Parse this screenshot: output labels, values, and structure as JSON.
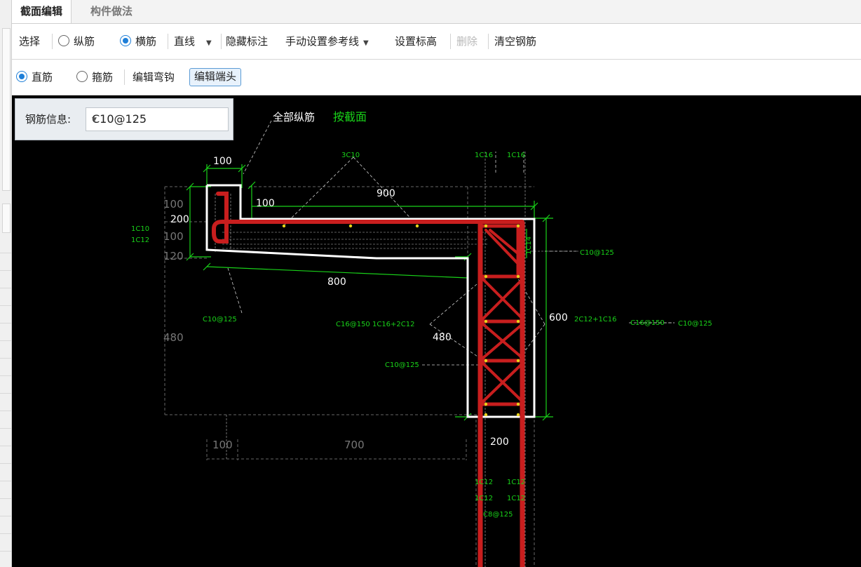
{
  "tabs": [
    {
      "label": "截面编辑",
      "active": true
    },
    {
      "label": "构件做法",
      "active": false
    }
  ],
  "toolbar1": {
    "select_label": "选择",
    "radio_longitudinal": "纵筋",
    "radio_transverse": "横筋",
    "line_type": "直线",
    "hide_annotation": "隐藏标注",
    "manual_ref_line": "手动设置参考线",
    "set_elevation": "设置标高",
    "delete": "删除",
    "clear_rebar": "清空钢筋"
  },
  "toolbar2": {
    "radio_straight": "直筋",
    "radio_stirrup": "箍筋",
    "edit_hook": "编辑弯钩",
    "edit_end": "编辑端头"
  },
  "rebar_info": {
    "label": "钢筋信息:",
    "value": "C10@125"
  },
  "drawing": {
    "all_longitudinal": "全部纵筋",
    "by_section": "按截面",
    "dims": {
      "d100_top": "100",
      "d100_flange": "100",
      "d900": "900",
      "d200_left": "200",
      "d800": "800",
      "d480_right": "480",
      "d600": "600",
      "d200_bottom": "200",
      "ghost100a": "100",
      "ghost100b": "100",
      "ghost120": "120",
      "ghost480": "480",
      "ghost100_bottom": "100",
      "ghost700": "700"
    },
    "labels": {
      "top_3c10": "3C10",
      "top_1c16_a": "1C16",
      "top_1c16_b": "1C16",
      "left_1c10": "1C10",
      "left_1c12": "1C12",
      "c10_125_right": "C10@125",
      "c10_125_left": "C10@125",
      "mid_left": "C16@150 1C16+2C12",
      "mid_right": "2C12+1C16",
      "mid_right2": "C16@150",
      "mid_right3": "C10@125",
      "c10_125_mid": "C10@125",
      "bot_1c12_a": "1C12",
      "bot_1c12_b": "1C12",
      "bot_1c12_c": "1C12",
      "bot_1c12_d": "1C12",
      "bot_c8_125": "C8@125",
      "vertical_1c14": "1C14"
    }
  },
  "colors": {
    "accent": "#1e7fd8",
    "rebar": "#c81e1e",
    "dimension": "#19d219",
    "concrete": "#ffffff",
    "background": "#000000"
  }
}
